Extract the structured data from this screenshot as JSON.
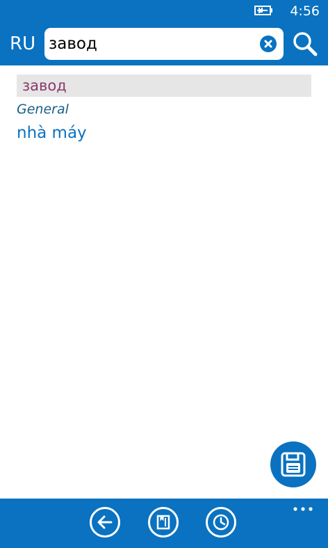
{
  "status_bar": {
    "time": "4:56",
    "battery_icon": "battery-charging-icon"
  },
  "header": {
    "language_code": "RU",
    "search": {
      "value": "завод",
      "placeholder": "",
      "clear_icon": "clear-icon"
    },
    "search_icon": "search-icon"
  },
  "result": {
    "headword": "завод",
    "category": "General",
    "translation": "nhà máy"
  },
  "fab": {
    "icon": "save-icon"
  },
  "app_bar": {
    "buttons": [
      {
        "icon": "back-arrow-icon"
      },
      {
        "icon": "bookmark-book-icon"
      },
      {
        "icon": "history-clock-icon"
      }
    ],
    "more_icon": "more-dots-icon"
  },
  "colors": {
    "accent": "#0a72c0",
    "headword": "#8a3a6a",
    "category": "#1a5f8a",
    "highlight_bg": "#e6e6e6"
  }
}
